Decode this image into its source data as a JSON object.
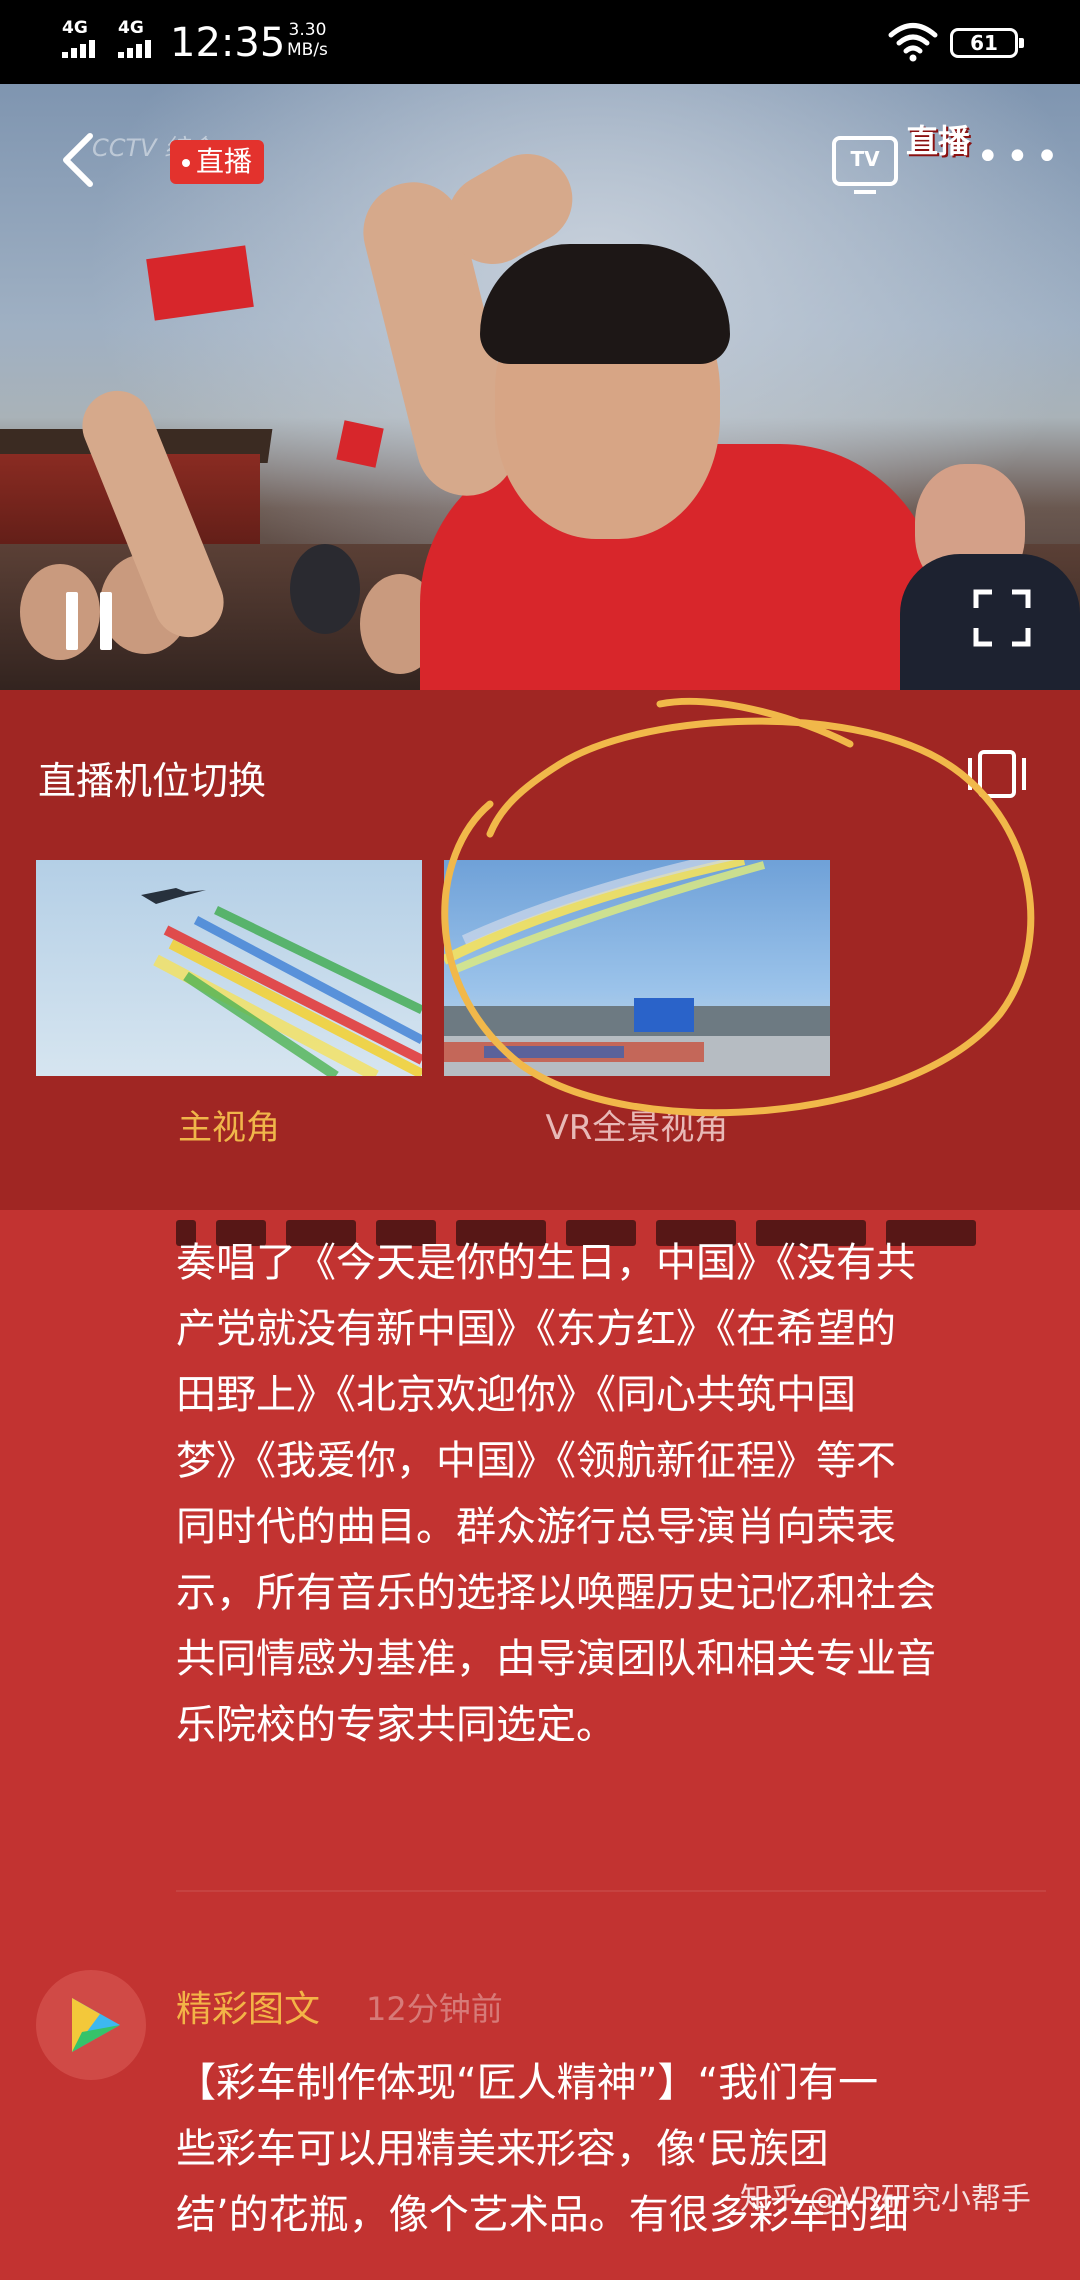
{
  "status_bar": {
    "signal_1": "4G",
    "signal_2": "4G",
    "time": "12:35",
    "speed_value": "3.30",
    "speed_unit": "MB/s",
    "battery": "61"
  },
  "player": {
    "channel_logo": "CCTV 综合",
    "live_badge": "直播",
    "tv_button": "TV",
    "watermark_live": "直播",
    "more_label": "•••"
  },
  "camera_switch": {
    "title": "直播机位切换",
    "options": [
      {
        "label": "主视角",
        "selected": true
      },
      {
        "label": "VR全景视角",
        "selected": false
      }
    ]
  },
  "article": {
    "paragraph_1": [
      "奏唱了《今天是你的生日，中国》《没有共",
      "产党就没有新中国》《东方红》《在希望的",
      "田野上》《北京欢迎你》《同心共筑中国",
      "梦》《我爱你，中国》《领航新征程》等不",
      "同时代的曲目。群众游行总导演肖向荣表",
      "示，所有音乐的选择以唤醒历史记忆和社会",
      "共同情感为基准，由导演团队和相关专业音",
      "乐院校的专家共同选定。"
    ],
    "feed_source": "精彩图文",
    "feed_time": "12分钟前",
    "paragraph_2": [
      "【彩车制作体现“匠人精神”】“我们有一",
      "些彩车可以用精美来形容，像‘民族团",
      "结’的花瓶，像个艺术品。有很多彩车的细"
    ]
  },
  "watermark": "知乎 @VR研究小帮手",
  "colors": {
    "page_background": "#c23331",
    "panel_background": "#a02623",
    "accent_orange": "#f0b64a",
    "live_red": "#e3322d",
    "annotation_circle": "#f1b84a"
  }
}
